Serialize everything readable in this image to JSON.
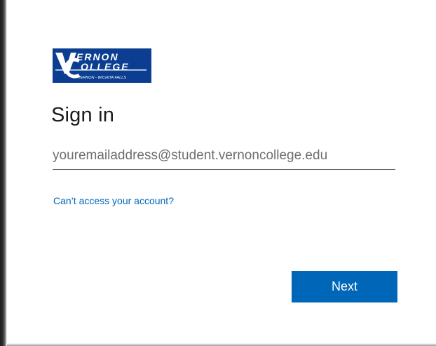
{
  "brand": {
    "logo_line1": "ERNON",
    "logo_line2": "OLLEGE",
    "logo_tagline": "VERNON - WICHITA FALLS",
    "logo_color": "#0b3d91"
  },
  "signin": {
    "title": "Sign in",
    "email_placeholder": "youremailaddress@student.vernoncollege.edu",
    "email_value": "",
    "help_link": "Can’t access your account?",
    "next_label": "Next"
  },
  "colors": {
    "primary": "#0067b8",
    "link": "#0067b8",
    "text": "#1b1b1b"
  }
}
